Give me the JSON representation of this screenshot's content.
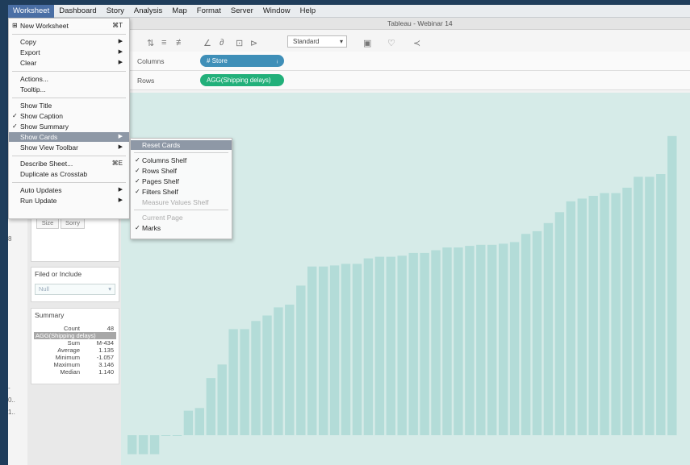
{
  "menubar": {
    "items": [
      "Worksheet",
      "Dashboard",
      "Story",
      "Analysis",
      "Map",
      "Format",
      "Server",
      "Window",
      "Help"
    ],
    "active_index": 0
  },
  "window": {
    "title": "Tableau - Webinar 14"
  },
  "toolbar": {
    "fit_select": "Standard"
  },
  "shelves": {
    "columns_label": "Columns",
    "columns_pill": "# Store",
    "rows_label": "Rows",
    "rows_pill": "AGG(Shipping delays)"
  },
  "left_panel": {
    "buttons": [
      "Size",
      "Sorry"
    ],
    "filter_title": "Filed or Include",
    "filter_value": "Null",
    "summary": {
      "title": "Summary",
      "highlight": "AGG(Shipping delays)",
      "rows": [
        {
          "k": "Count",
          "v": "48"
        },
        {
          "k": "Sum",
          "v": "M-434"
        },
        {
          "k": "Average",
          "v": "1.135"
        },
        {
          "k": "Minimum",
          "v": "-1.057"
        },
        {
          "k": "Maximum",
          "v": "3.146"
        },
        {
          "k": "Median",
          "v": "1.140"
        }
      ]
    }
  },
  "worksheet_menu": {
    "items": [
      {
        "label": "New Worksheet",
        "shortcut": "⌘T",
        "check": false,
        "submenu": false
      },
      {
        "label": "Copy",
        "shortcut": "",
        "check": false,
        "submenu": true
      },
      {
        "label": "Export",
        "shortcut": "",
        "check": false,
        "submenu": true
      },
      {
        "label": "Clear",
        "shortcut": "",
        "check": false,
        "submenu": true
      },
      {
        "label": "Actions...",
        "shortcut": "",
        "check": false,
        "submenu": false
      },
      {
        "label": "Tooltip...",
        "shortcut": "",
        "check": false,
        "submenu": false
      },
      {
        "label": "Show Title",
        "shortcut": "",
        "check": false,
        "submenu": false
      },
      {
        "label": "Show Caption",
        "shortcut": "",
        "check": true,
        "submenu": false
      },
      {
        "label": "Show Summary",
        "shortcut": "",
        "check": true,
        "submenu": false
      },
      {
        "label": "Show Cards",
        "shortcut": "",
        "check": false,
        "submenu": true
      },
      {
        "label": "Show View Toolbar",
        "shortcut": "",
        "check": false,
        "submenu": true
      },
      {
        "label": "Describe Sheet...",
        "shortcut": "⌘E",
        "check": false,
        "submenu": false
      },
      {
        "label": "Duplicate as Crosstab",
        "shortcut": "",
        "check": false,
        "submenu": false
      },
      {
        "label": "Auto Updates",
        "shortcut": "",
        "check": false,
        "submenu": true
      },
      {
        "label": "Run Update",
        "shortcut": "",
        "check": false,
        "submenu": true
      }
    ],
    "highlight_index": 9
  },
  "cards_submenu": {
    "items": [
      {
        "label": "Reset Cards",
        "check": false,
        "disabled": false
      },
      {
        "label": "Columns Shelf",
        "check": true,
        "disabled": false
      },
      {
        "label": "Rows Shelf",
        "check": true,
        "disabled": false
      },
      {
        "label": "Pages Shelf",
        "check": true,
        "disabled": false
      },
      {
        "label": "Filters Shelf",
        "check": true,
        "disabled": false
      },
      {
        "label": "Measure Values Shelf",
        "check": false,
        "disabled": true
      },
      {
        "label": "Current Page",
        "check": false,
        "disabled": true
      },
      {
        "label": "Marks",
        "check": true,
        "disabled": false
      }
    ],
    "highlight_index": 0
  },
  "chart_data": {
    "type": "bar",
    "values": [
      -0.35,
      -0.35,
      -0.35,
      0.0,
      0.0,
      0.45,
      0.5,
      1.05,
      1.3,
      1.95,
      1.95,
      2.1,
      2.2,
      2.35,
      2.4,
      2.75,
      3.1,
      3.1,
      3.12,
      3.15,
      3.15,
      3.25,
      3.28,
      3.28,
      3.3,
      3.35,
      3.35,
      3.4,
      3.45,
      3.45,
      3.48,
      3.5,
      3.5,
      3.52,
      3.55,
      3.7,
      3.75,
      3.9,
      4.1,
      4.3,
      4.35,
      4.4,
      4.45,
      4.45,
      4.55,
      4.75,
      4.75,
      4.8,
      5.5
    ],
    "bar_color": "#b3dcd8",
    "background": "#d6ebe8",
    "ylim": [
      -0.4,
      6.0
    ],
    "grid": false
  }
}
